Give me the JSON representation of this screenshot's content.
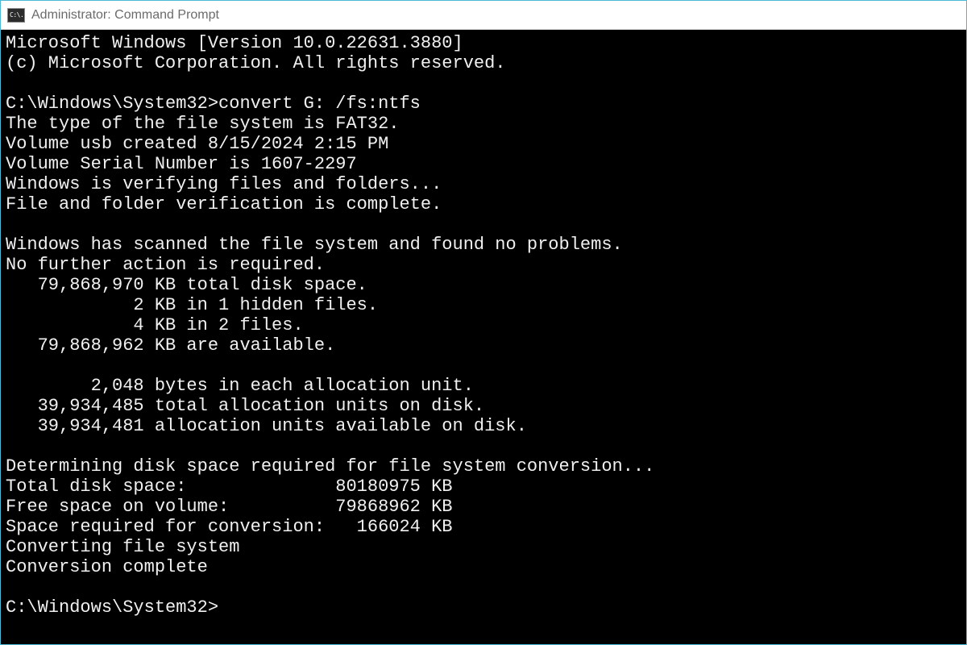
{
  "window": {
    "icon_label": "C:\\.",
    "title": "Administrator: Command Prompt"
  },
  "terminal": {
    "lines": [
      "Microsoft Windows [Version 10.0.22631.3880]",
      "(c) Microsoft Corporation. All rights reserved.",
      "",
      "C:\\Windows\\System32>convert G: /fs:ntfs",
      "The type of the file system is FAT32.",
      "Volume usb created 8/15/2024 2:15 PM",
      "Volume Serial Number is 1607-2297",
      "Windows is verifying files and folders...",
      "File and folder verification is complete.",
      "",
      "Windows has scanned the file system and found no problems.",
      "No further action is required.",
      "   79,868,970 KB total disk space.",
      "            2 KB in 1 hidden files.",
      "            4 KB in 2 files.",
      "   79,868,962 KB are available.",
      "",
      "        2,048 bytes in each allocation unit.",
      "   39,934,485 total allocation units on disk.",
      "   39,934,481 allocation units available on disk.",
      "",
      "Determining disk space required for file system conversion...",
      "Total disk space:              80180975 KB",
      "Free space on volume:          79868962 KB",
      "Space required for conversion:   166024 KB",
      "Converting file system",
      "Conversion complete",
      "",
      "C:\\Windows\\System32>"
    ],
    "prompt": "C:\\Windows\\System32>",
    "command_entered": "convert G: /fs:ntfs"
  }
}
